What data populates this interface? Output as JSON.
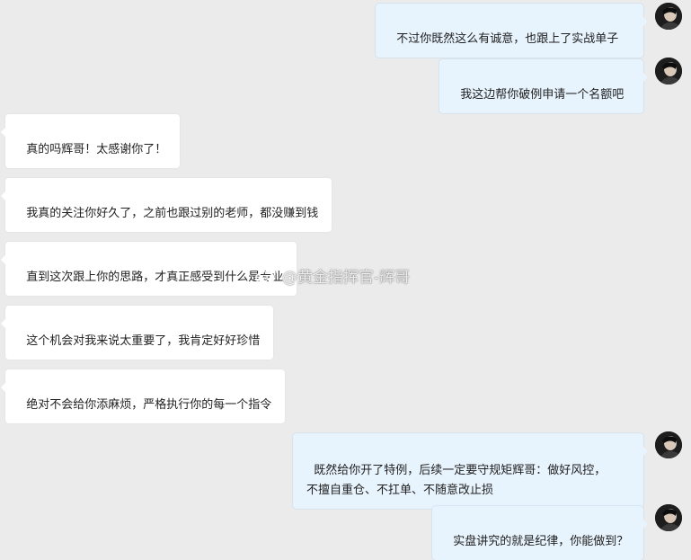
{
  "messages": [
    {
      "side": "right",
      "text": "不过你既然这么有诚意，也跟上了实战单子"
    },
    {
      "side": "right",
      "text": "我这边帮你破例申请一个名额吧"
    },
    {
      "side": "left",
      "text": "真的吗辉哥！太感谢你了！"
    },
    {
      "side": "left",
      "text": "我真的关注你好久了，之前也跟过别的老师，都没赚到钱"
    },
    {
      "side": "left",
      "text": "直到这次跟上你的思路，才真正感受到什么是专业"
    },
    {
      "side": "left",
      "text": "这个机会对我来说太重要了，我肯定好好珍惜"
    },
    {
      "side": "left",
      "text": "绝对不会给你添麻烦，严格执行你的每一个指令"
    },
    {
      "side": "right",
      "text": "既然给你开了特例，后续一定要守规矩辉哥：做好风控，\n不擅自重仓、不扛单、不随意改止损"
    },
    {
      "side": "right",
      "text": "实盘讲究的就是纪律，你能做到？"
    }
  ],
  "watermark": {
    "text": "@黄金指挥官-辉哥",
    "icon": "weibo-logo-icon"
  },
  "avatar": {
    "icon": "user-avatar-icon"
  },
  "colors": {
    "background": "#ebebeb",
    "bubble_left": "#ffffff",
    "bubble_right": "#e7f3fd",
    "text": "#222222"
  }
}
